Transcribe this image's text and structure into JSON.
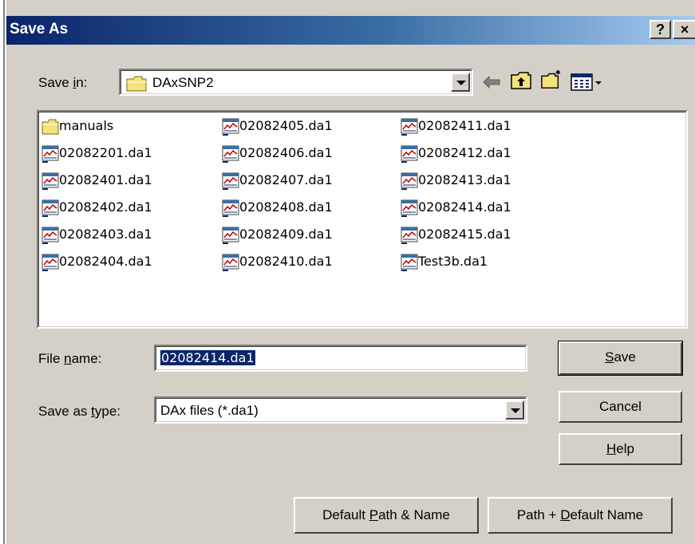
{
  "dialog": {
    "title": "Save As",
    "help_button": "?",
    "close_button": "×"
  },
  "save_in": {
    "label_pre": "Save ",
    "label_ul": "i",
    "label_post": "n:",
    "value": "DAxSNP2"
  },
  "toolbar": {
    "back": "back-arrow-icon",
    "up": "up-one-level-icon",
    "new_folder": "new-folder-icon",
    "view_menu": "view-menu-icon"
  },
  "files": {
    "col1": [
      "manuals",
      "02082201.da1",
      "02082401.da1",
      "02082402.da1",
      "02082403.da1",
      "02082404.da1"
    ],
    "col2": [
      "02082405.da1",
      "02082406.da1",
      "02082407.da1",
      "02082408.da1",
      "02082409.da1",
      "02082410.da1"
    ],
    "col3": [
      "02082411.da1",
      "02082412.da1",
      "02082413.da1",
      "02082414.da1",
      "02082415.da1",
      "Test3b.da1"
    ]
  },
  "file_name": {
    "label_pre": "File ",
    "label_ul": "n",
    "label_post": "ame:",
    "value": "02082414.da1"
  },
  "save_type": {
    "label_pre": "Save as ",
    "label_ul": "t",
    "label_post": "ype:",
    "value": "DAx files (*.da1)"
  },
  "buttons": {
    "save_ul": "S",
    "save_rest": "ave",
    "cancel": "Cancel",
    "help_ul": "H",
    "help_rest": "elp",
    "default_path_pre": "Default ",
    "default_path_ul": "P",
    "default_path_post": "ath & Name",
    "path_default_pre": "Path + ",
    "path_default_ul": "D",
    "path_default_post": "efault Name"
  },
  "colors": {
    "title_start": "#0a246a",
    "title_end": "#a6caf0",
    "face": "#d4d0c8",
    "selection": "#0a246a"
  }
}
